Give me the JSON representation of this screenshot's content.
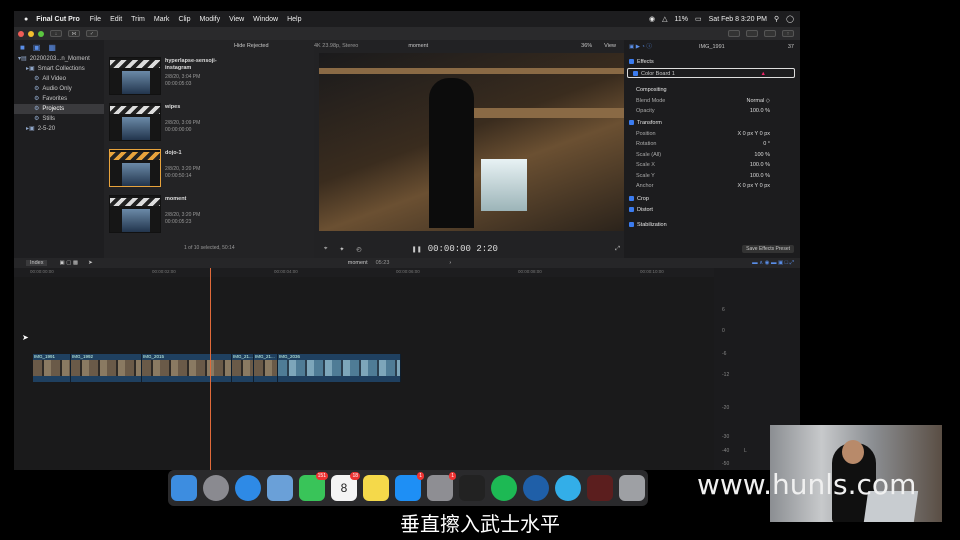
{
  "menubar": {
    "app": "Final Cut Pro",
    "items": [
      "File",
      "Edit",
      "Trim",
      "Mark",
      "Clip",
      "Modify",
      "View",
      "Window",
      "Help"
    ],
    "battery": "11%",
    "clock": "Sat Feb 8  3:20 PM"
  },
  "sidebar": {
    "items": [
      {
        "label": "20200203...n_Moment",
        "indent": 0
      },
      {
        "label": "Smart Collections",
        "indent": 1
      },
      {
        "label": "All Video",
        "indent": 2
      },
      {
        "label": "Audio Only",
        "indent": 2
      },
      {
        "label": "Favorites",
        "indent": 2
      },
      {
        "label": "Projects",
        "indent": 2,
        "selected": true
      },
      {
        "label": "Stills",
        "indent": 2
      },
      {
        "label": "2-5-20",
        "indent": 1
      }
    ]
  },
  "browser": {
    "filter": "Hide Rejected",
    "footer": "1 of 10 selected, 50:14",
    "clips": [
      {
        "name": "hyperlapse-sensoji-\ninstagram",
        "date": "2/8/20, 3:04 PM",
        "duration": "00:00:05:03"
      },
      {
        "name": "wipes",
        "date": "2/8/20, 3:09 PM",
        "duration": "00:00:00:00"
      },
      {
        "name": "dojo-1",
        "date": "2/8/20, 3:20 PM",
        "duration": "00:00:50:14",
        "selected": true
      },
      {
        "name": "moment",
        "date": "2/8/20, 3:20 PM",
        "duration": "00:00:05:23"
      }
    ]
  },
  "viewer": {
    "format": "4K 23.98p, Stereo",
    "project": "moment",
    "zoom": "36%",
    "view": "View",
    "timecode": "00:00:00 2:20"
  },
  "inspector": {
    "clip": "IMG_1991",
    "duration": "37",
    "effects_label": "Effects",
    "color_board": "Color Board 1",
    "rows": [
      {
        "label": "Compositing",
        "value": "",
        "header": true
      },
      {
        "label": "Blend Mode",
        "value": "Normal ◇"
      },
      {
        "label": "Opacity",
        "value": "100.0 %"
      },
      {
        "label": "Transform",
        "value": "",
        "header": true
      },
      {
        "label": "Position",
        "value": "X  0 px   Y  0 px"
      },
      {
        "label": "Rotation",
        "value": "0 °"
      },
      {
        "label": "Scale (All)",
        "value": "100 %"
      },
      {
        "label": "Scale X",
        "value": "100.0 %"
      },
      {
        "label": "Scale Y",
        "value": "100.0 %"
      },
      {
        "label": "Anchor",
        "value": "X  0 px   Y  0 px"
      },
      {
        "label": "Crop",
        "value": "",
        "header": true
      },
      {
        "label": "Distort",
        "value": "",
        "header": true
      },
      {
        "label": "Stabilization",
        "value": "",
        "header": true
      }
    ],
    "save_preset": "Save Effects Preset"
  },
  "timeline": {
    "index": "Index",
    "project": "moment",
    "duration": "05:23",
    "ruler": [
      "00:00:00:00",
      "00:00:02:00",
      "00:00:04:00",
      "00:00:06:00",
      "00:00:08:00",
      "00:00:10:00"
    ],
    "clips": [
      {
        "name": "IMG_1991",
        "style": "warm"
      },
      {
        "name": "IMG_1992",
        "style": "warm"
      },
      {
        "name": "IMG_2015",
        "style": "warm"
      },
      {
        "name": "IMG_21...",
        "style": "warm"
      },
      {
        "name": "IMG_21...",
        "style": "warm"
      },
      {
        "name": "IMG_2036",
        "style": "blue"
      }
    ],
    "meter_labels": [
      "6",
      "0",
      "-6",
      "-12",
      "-20",
      "-30",
      "-40",
      "-50",
      "L",
      "R"
    ]
  },
  "dock": {
    "apps": [
      {
        "name": "finder-icon",
        "color": "#3d8de0"
      },
      {
        "name": "launchpad-icon",
        "color": "#8a8a90"
      },
      {
        "name": "safari-icon",
        "color": "#2e8ae6"
      },
      {
        "name": "preview-icon",
        "color": "#6aa0d8"
      },
      {
        "name": "messages-icon",
        "color": "#39c459",
        "badge": "151"
      },
      {
        "name": "calendar-icon",
        "color": "#f4f4f4",
        "badge": "18",
        "text": "8"
      },
      {
        "name": "notes-icon",
        "color": "#f5d94a"
      },
      {
        "name": "app-store-icon",
        "color": "#1e8ff5",
        "badge": "1"
      },
      {
        "name": "system-preferences-icon",
        "color": "#8e8e93",
        "badge": "1"
      },
      {
        "name": "final-cut-pro-icon",
        "color": "#222"
      },
      {
        "name": "spotify-icon",
        "color": "#1db954"
      },
      {
        "name": "quicktime-icon",
        "color": "#1f5fa8"
      },
      {
        "name": "browser-icon",
        "color": "#33aee8"
      },
      {
        "name": "photo-booth-icon",
        "color": "#5b1e1e"
      },
      {
        "name": "trash-icon",
        "color": "#9ea0a4"
      }
    ]
  },
  "overlay": {
    "watermark": "www.hunls.com",
    "subtitle": "垂直擦入武士水平"
  }
}
